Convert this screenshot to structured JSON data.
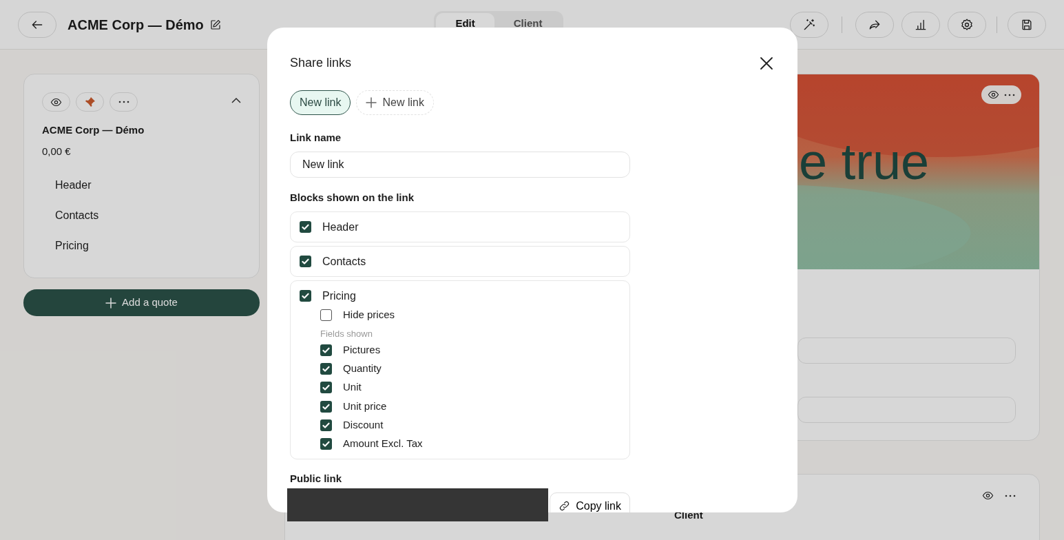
{
  "topbar": {
    "title": "ACME Corp — Démo",
    "mode_tabs": [
      {
        "label": "Edit",
        "selected": true
      },
      {
        "label": "Client",
        "selected": false
      }
    ]
  },
  "sidebar": {
    "pinned": true,
    "expanded": true,
    "quote_title": "ACME Corp — Démo",
    "total": "0,00 €",
    "sections": [
      "Header",
      "Contacts",
      "Pricing"
    ],
    "add_button": "Add a quote"
  },
  "preview": {
    "hero_text": "e true",
    "lower_label": "Client"
  },
  "modal": {
    "title": "Share links",
    "links": [
      {
        "label": "New link",
        "selected": true
      }
    ],
    "add_link": "New link",
    "link_name_label": "Link name",
    "link_name_value": "New link",
    "blocks_label": "Blocks shown on the link",
    "blocks": [
      {
        "label": "Header",
        "checked": true
      },
      {
        "label": "Contacts",
        "checked": true
      },
      {
        "label": "Pricing",
        "checked": true,
        "hide_prices": {
          "label": "Hide prices",
          "checked": false
        },
        "fields_label": "Fields shown",
        "fields": [
          {
            "label": "Pictures",
            "checked": true
          },
          {
            "label": "Quantity",
            "checked": true
          },
          {
            "label": "Unit",
            "checked": true
          },
          {
            "label": "Unit price",
            "checked": true
          },
          {
            "label": "Discount",
            "checked": true
          },
          {
            "label": "Amount Excl. Tax",
            "checked": true
          }
        ]
      }
    ],
    "public_link_label": "Public link",
    "copy_button": "Copy link"
  }
}
